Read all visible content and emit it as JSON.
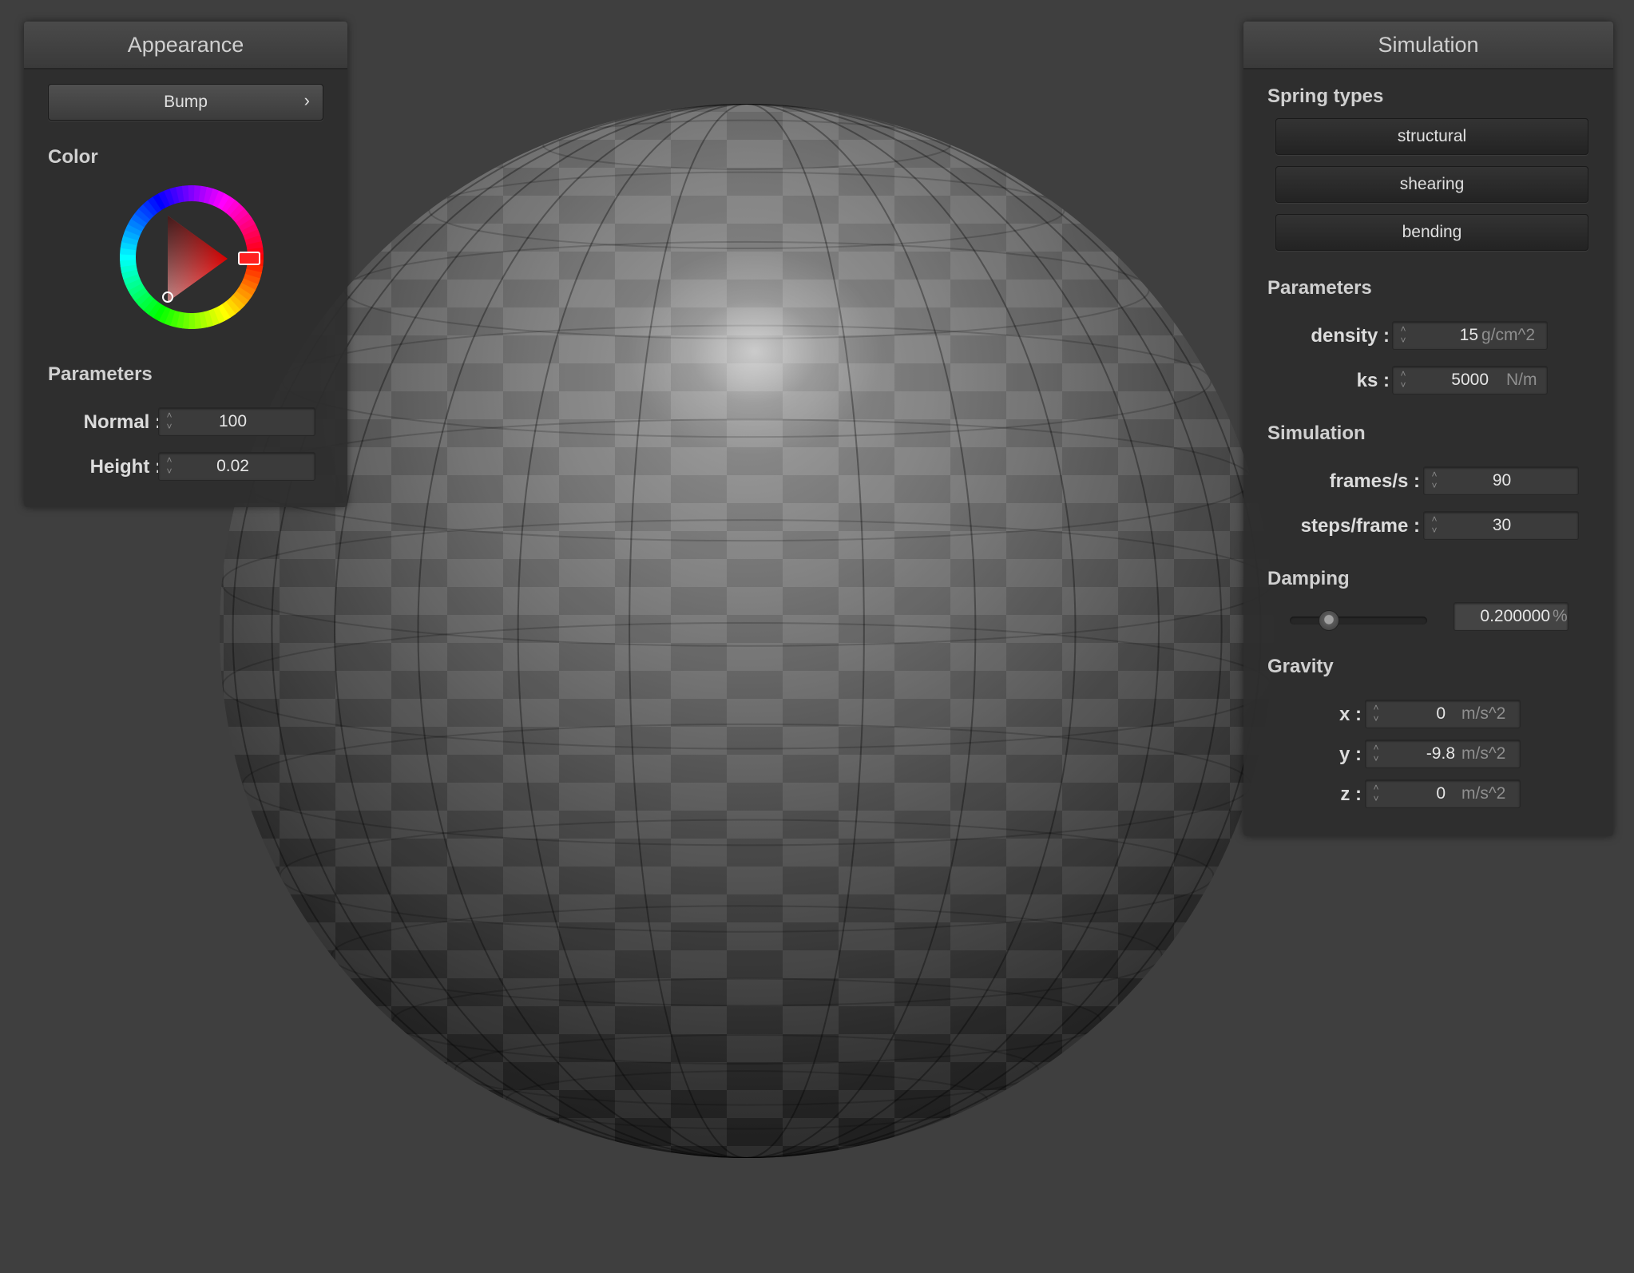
{
  "appearance": {
    "title": "Appearance",
    "mode_button": "Bump",
    "chevron": "›",
    "color_label": "Color",
    "selected_hue": "#ff0000",
    "parameters_label": "Parameters",
    "normal_label": "Normal :",
    "normal_value": "100",
    "height_label": "Height :",
    "height_value": "0.02"
  },
  "simulation": {
    "title": "Simulation",
    "spring_types_label": "Spring types",
    "spring_buttons": [
      "structural",
      "shearing",
      "bending"
    ],
    "parameters_label": "Parameters",
    "density_label": "density :",
    "density_value": "15",
    "density_unit": "g/cm^2",
    "ks_label": "ks :",
    "ks_value": "5000",
    "ks_unit": "N/m",
    "sim_label": "Simulation",
    "fps_label": "frames/s :",
    "fps_value": "90",
    "steps_label": "steps/frame :",
    "steps_value": "30",
    "damping_label": "Damping",
    "damping_fraction": 0.2,
    "damping_value": "0.200000",
    "damping_unit": "%",
    "gravity_label": "Gravity",
    "gx_label": "x :",
    "gx_value": "0",
    "gy_label": "y :",
    "gy_value": "-9.8",
    "gz_label": "z :",
    "gz_value": "0",
    "gravity_unit": "m/s^2"
  },
  "icons": {
    "spinner": "spinner-arrows-icon"
  }
}
